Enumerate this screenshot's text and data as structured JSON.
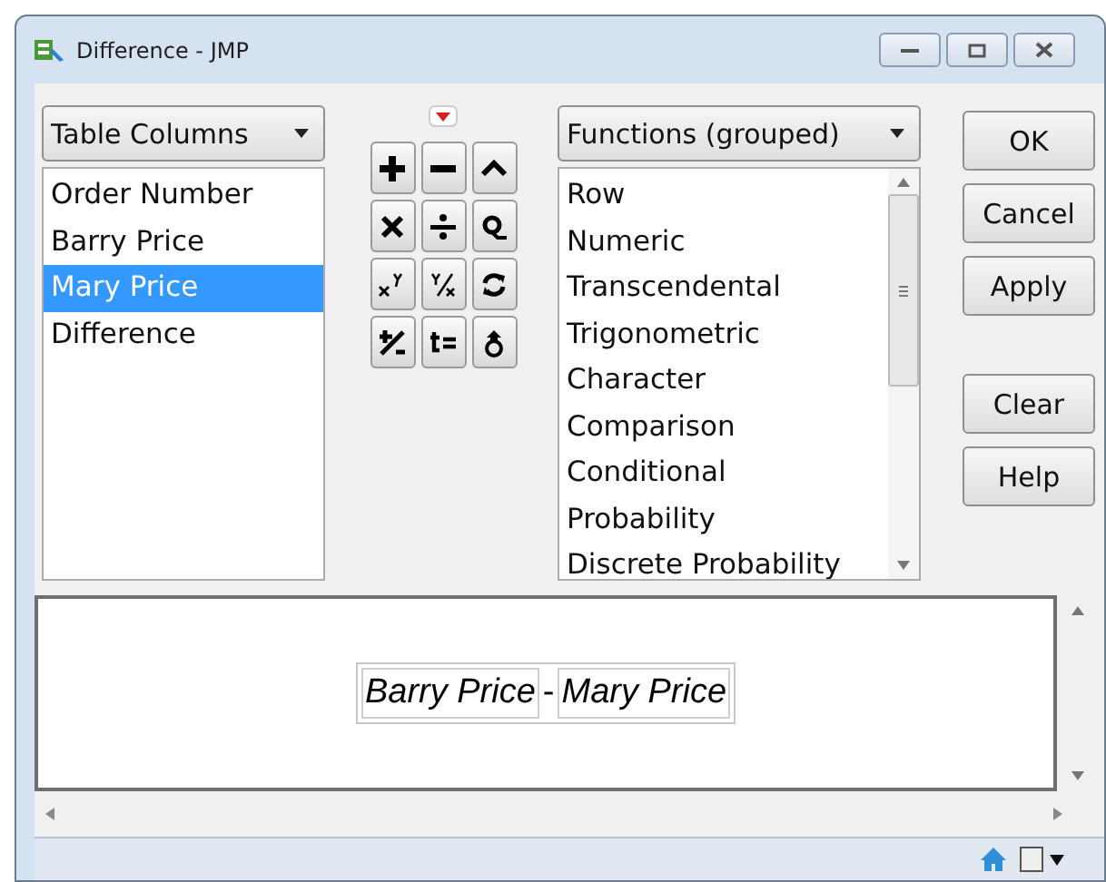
{
  "window": {
    "title": "Difference - JMP"
  },
  "columns_dropdown": {
    "label": "Table Columns"
  },
  "columns": [
    {
      "label": "Order Number",
      "selected": false
    },
    {
      "label": "Barry Price",
      "selected": false
    },
    {
      "label": "Mary Price",
      "selected": true
    },
    {
      "label": "Difference",
      "selected": false
    }
  ],
  "keypad": [
    {
      "kind": "plus"
    },
    {
      "kind": "minus"
    },
    {
      "kind": "caret"
    },
    {
      "kind": "times"
    },
    {
      "kind": "divide"
    },
    {
      "kind": "loop"
    },
    {
      "kind": "power"
    },
    {
      "kind": "root"
    },
    {
      "kind": "swap"
    },
    {
      "kind": "sign"
    },
    {
      "kind": "assign"
    },
    {
      "kind": "peel"
    }
  ],
  "functions_dropdown": {
    "label": "Functions (grouped)"
  },
  "functions": [
    "Row",
    "Numeric",
    "Transcendental",
    "Trigonometric",
    "Character",
    "Comparison",
    "Conditional",
    "Probability",
    "Discrete Probability"
  ],
  "buttons": [
    {
      "label": "OK",
      "kind": "action"
    },
    {
      "label": "Cancel",
      "kind": "action"
    },
    {
      "label": "Apply",
      "kind": "action"
    },
    {
      "label": "Clear",
      "kind": "edit"
    },
    {
      "label": "Help",
      "kind": "edit"
    }
  ],
  "formula": {
    "left": "Barry Price",
    "operator": "-",
    "right": "Mary Price"
  }
}
